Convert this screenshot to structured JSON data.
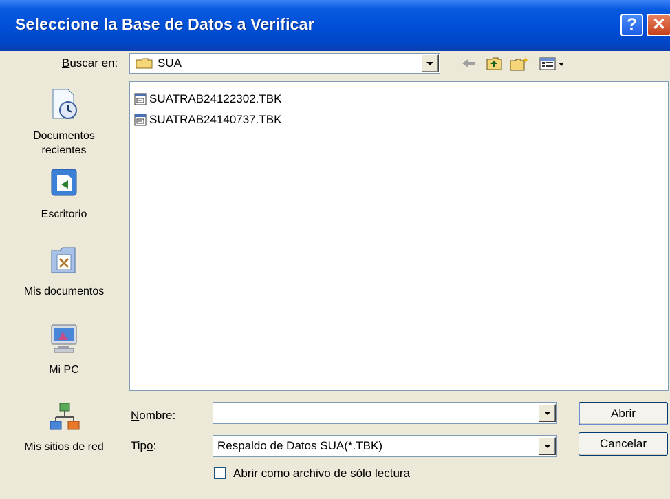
{
  "window": {
    "title": "Seleccione la Base de Datos a Verificar",
    "help": "?",
    "close": "✕"
  },
  "lookin": {
    "label_pre": "",
    "label_u": "B",
    "label_post": "uscar en:",
    "value": "SUA"
  },
  "places": [
    {
      "line1": "Documentos",
      "line2": "recientes"
    },
    {
      "line1": "Escritorio",
      "line2": ""
    },
    {
      "line1": "Mis documentos",
      "line2": ""
    },
    {
      "line1": "Mi PC",
      "line2": ""
    },
    {
      "line1": "Mis sitios de red",
      "line2": ""
    }
  ],
  "files": [
    "SUATRAB24122302.TBK",
    "SUATRAB24140737.TBK"
  ],
  "filename": {
    "label_u": "N",
    "label_post": "ombre:",
    "value": ""
  },
  "filetype": {
    "label_pre": "Tip",
    "label_u": "o",
    "label_post": ":",
    "value": "Respaldo de Datos SUA(*.TBK)"
  },
  "buttons": {
    "open_u": "A",
    "open_post": "brir",
    "cancel": "Cancelar"
  },
  "readonly": {
    "pre": "Abrir como archivo de ",
    "u": "s",
    "post": "ólo lectura"
  }
}
